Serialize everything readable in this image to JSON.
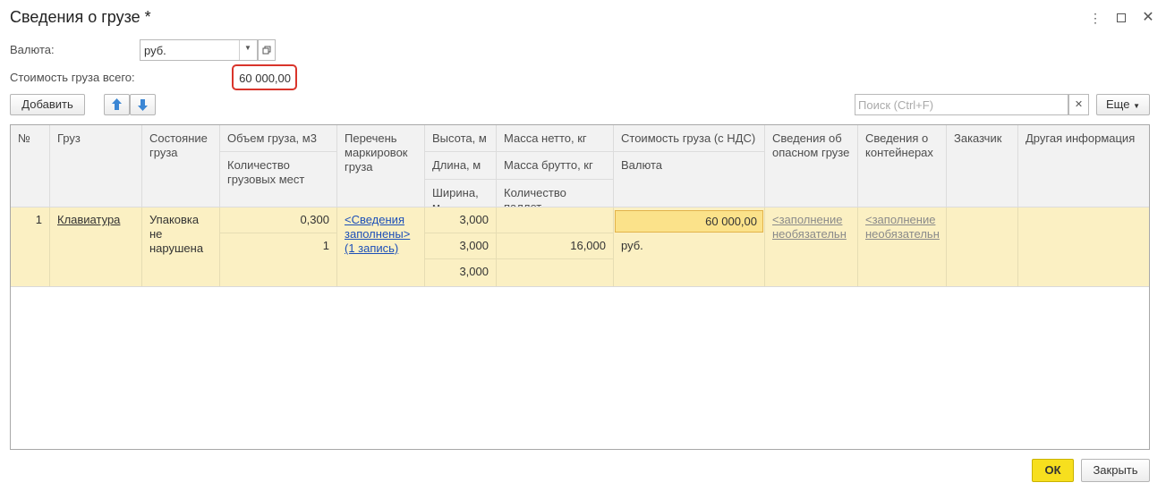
{
  "window": {
    "title": "Сведения о грузе *"
  },
  "form": {
    "currency_label": "Валюта:",
    "currency_value": "руб.",
    "total_label": "Стоимость груза всего:",
    "total_value": "60 000,00"
  },
  "toolbar": {
    "add_label": "Добавить",
    "search_placeholder": "Поиск (Ctrl+F)",
    "more_label": "Еще"
  },
  "table": {
    "headers": {
      "num": "№",
      "cargo": "Груз",
      "state": "Состояние груза",
      "volume": "Объем груза, м3",
      "places": "Количество грузовых мест",
      "markings": "Перечень маркировок груза",
      "height": "Высота, м",
      "length": "Длина, м",
      "width": "Ширина, м",
      "net": "Масса нетто, кг",
      "gross": "Масса брутто, кг",
      "pallets": "Количество паллет",
      "cost": "Стоимость груза (с НДС)",
      "currency": "Валюта",
      "danger": "Сведения об опасном грузе",
      "containers": "Сведения о контейнерах",
      "customer": "Заказчик",
      "other": "Другая информация"
    },
    "rows": [
      {
        "num": "1",
        "cargo": "Клавиатура",
        "state": "Упаковка не нарушена",
        "volume": "0,300",
        "places": "1",
        "markings": "<Сведения заполнены> (1 запись)",
        "height": "3,000",
        "length": "3,000",
        "width": "3,000",
        "net": "",
        "gross": "16,000",
        "pallets": "",
        "cost": "60 000,00",
        "currency": "руб.",
        "danger": "<заполнение необязательн",
        "containers": "<заполнение необязательн",
        "customer": "",
        "other": ""
      }
    ]
  },
  "footer": {
    "ok_label": "ОК",
    "close_label": "Закрыть"
  },
  "colors": {
    "row_bg": "#fbf0c3",
    "ok_bg": "#f7df1e",
    "highlight_border": "#d9342b",
    "link": "#1c4fb8"
  },
  "icons": [
    "more-vertical-icon",
    "maximize-icon",
    "close-icon",
    "dropdown-arrow-icon",
    "open-icon",
    "arrow-up-icon",
    "arrow-down-icon",
    "clear-icon",
    "chevron-down-icon"
  ]
}
